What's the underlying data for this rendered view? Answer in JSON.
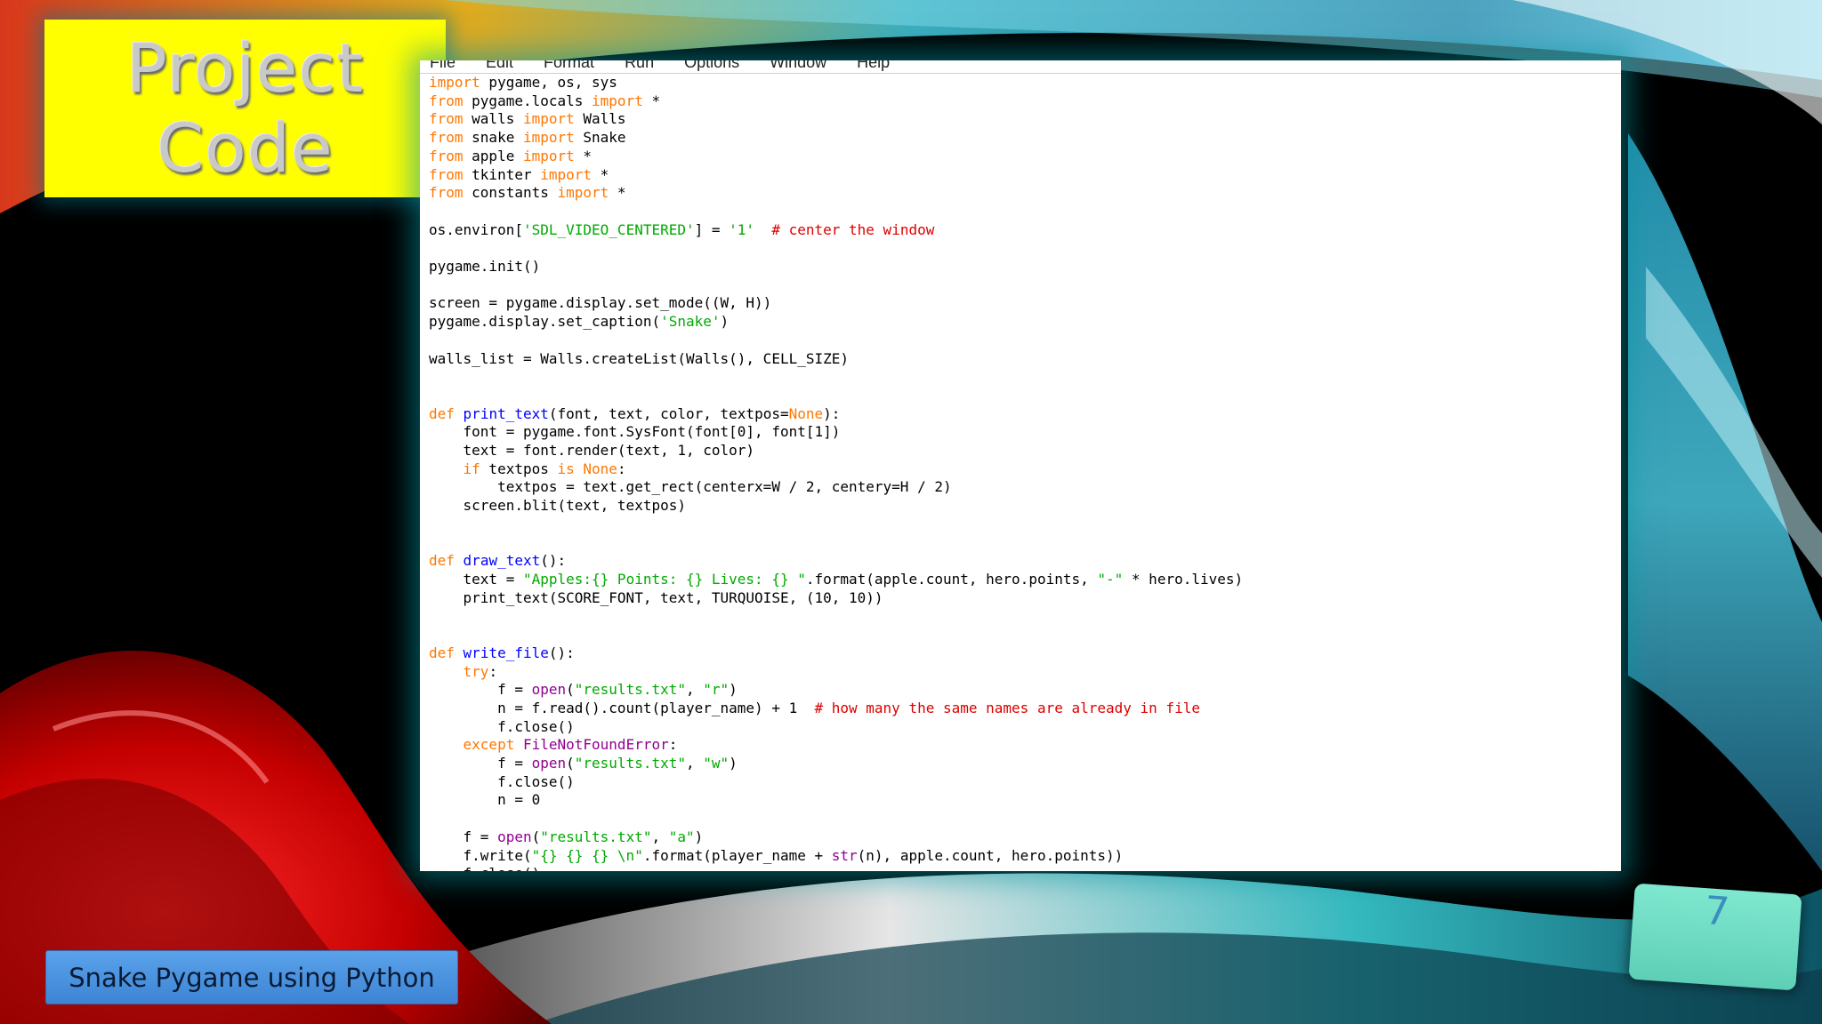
{
  "slide": {
    "title_line1": "Project",
    "title_line2": "Code",
    "footer": "Snake Pygame using Python",
    "page_number": "7"
  },
  "editor": {
    "menu": [
      "File",
      "Edit",
      "Format",
      "Run",
      "Options",
      "Window",
      "Help"
    ],
    "code_lines": [
      "import pygame, os, sys",
      "from pygame.locals import *",
      "from walls import Walls",
      "from snake import Snake",
      "from apple import *",
      "from tkinter import *",
      "from constants import *",
      "",
      "os.environ['SDL_VIDEO_CENTERED'] = '1'  # center the window",
      "",
      "pygame.init()",
      "",
      "screen = pygame.display.set_mode((W, H))",
      "pygame.display.set_caption('Snake')",
      "",
      "walls_list = Walls.createList(Walls(), CELL_SIZE)",
      "",
      "",
      "def print_text(font, text, color, textpos=None):",
      "    font = pygame.font.SysFont(font[0], font[1])",
      "    text = font.render(text, 1, color)",
      "    if textpos is None:",
      "        textpos = text.get_rect(centerx=W / 2, centery=H / 2)",
      "    screen.blit(text, textpos)",
      "",
      "",
      "def draw_text():",
      "    text = \"Apples:{} Points: {} Lives: {} \".format(apple.count, hero.points, \"-\" * hero.lives)",
      "    print_text(SCORE_FONT, text, TURQUOISE, (10, 10))",
      "",
      "",
      "def write_file():",
      "    try:",
      "        f = open(\"results.txt\", \"r\")",
      "        n = f.read().count(player_name) + 1  # how many the same names are already in file",
      "        f.close()",
      "    except FileNotFoundError:",
      "        f = open(\"results.txt\", \"w\")",
      "        f.close()",
      "        n = 0",
      "",
      "    f = open(\"results.txt\", \"a\")",
      "    f.write(\"{} {} {} \\n\".format(player_name + str(n), apple.count, hero.points))",
      "    f.close()"
    ]
  },
  "colors": {
    "title_bg": "#ffff00",
    "footer_bg": "#4a93e0",
    "page_box_bg": "#6fdcc3",
    "keyword": "#ff7700",
    "string": "#00aa00",
    "comment": "#dd0000",
    "definition": "#0000ff",
    "builtin": "#900090"
  }
}
